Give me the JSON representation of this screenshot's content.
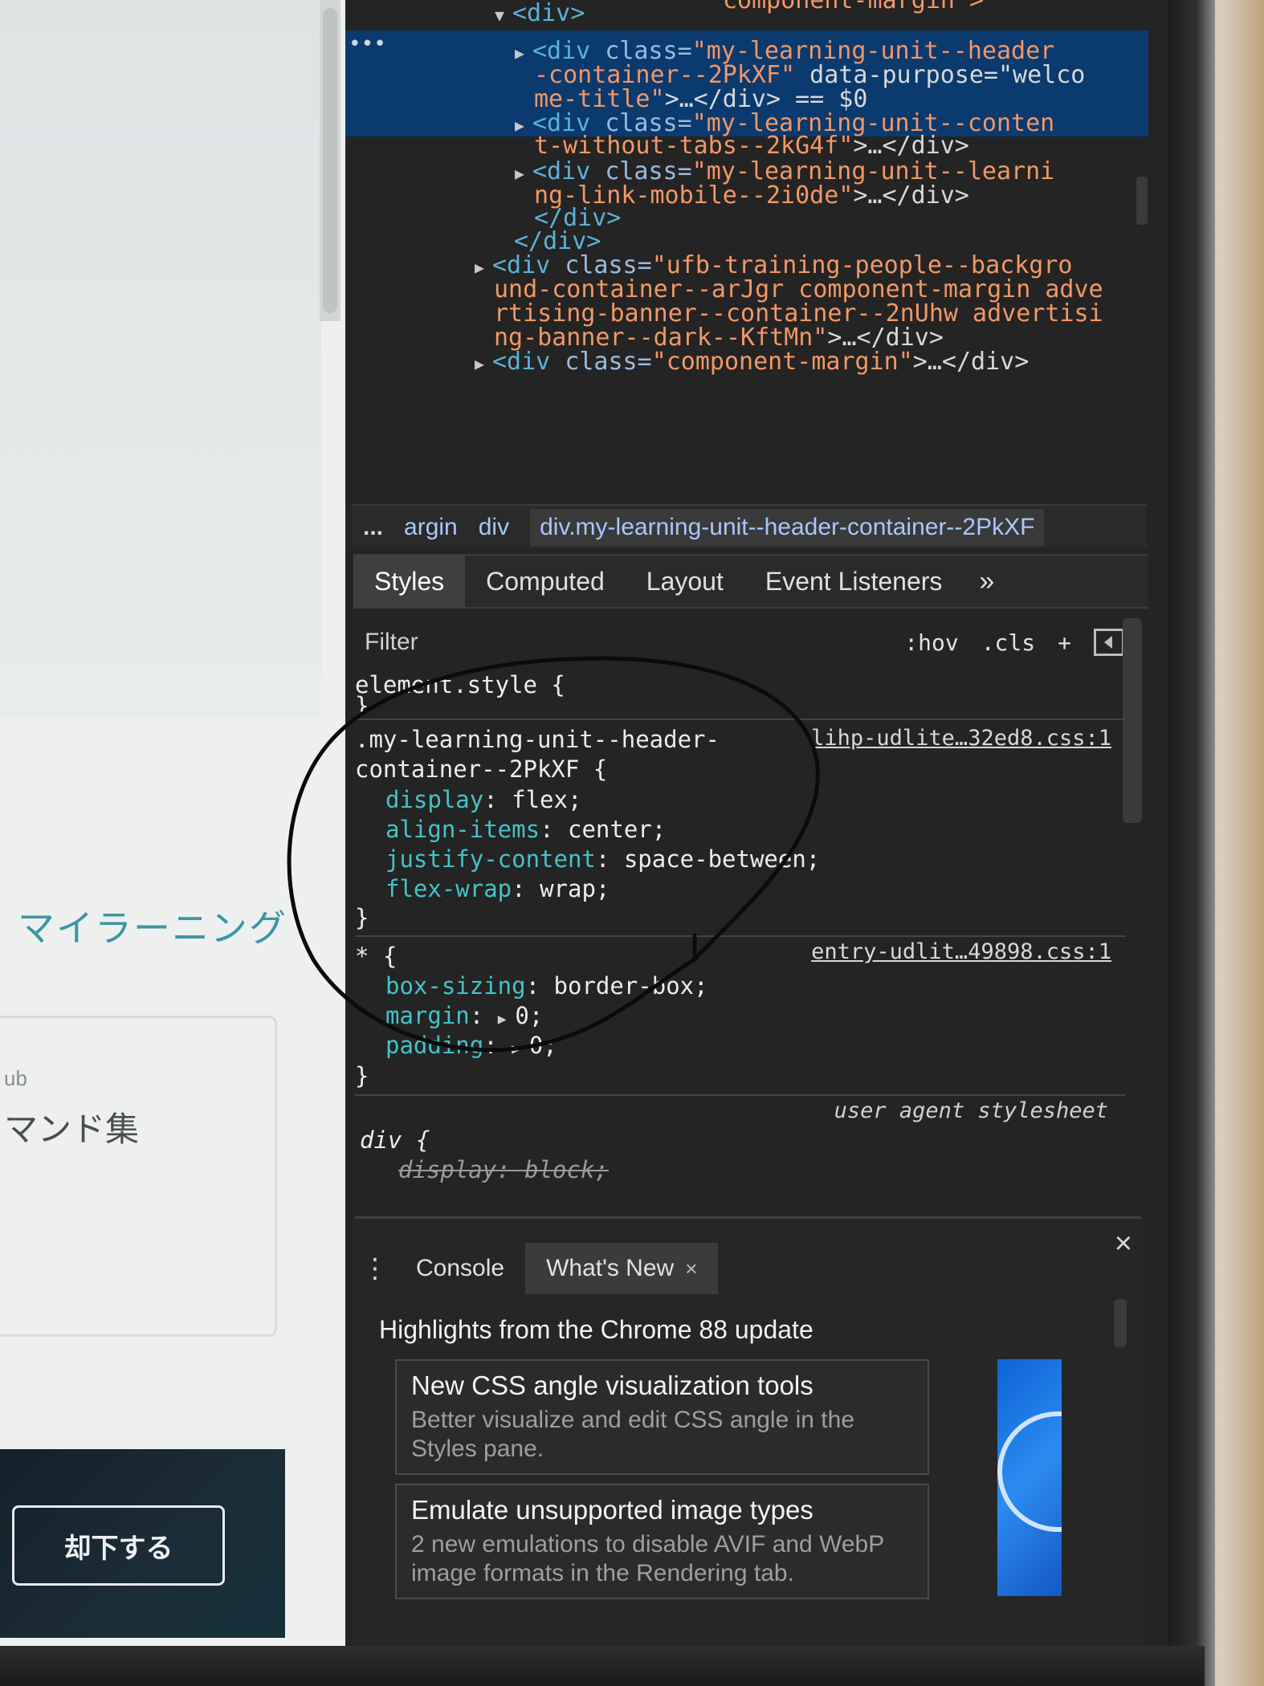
{
  "page": {
    "section_title": "マイラーニング",
    "card_subtitle": "ub",
    "card_title": "マンド集",
    "reject_button": "却下する"
  },
  "elements": {
    "lines": [
      {
        "open": "▼",
        "tag": "<div>",
        "attr": "",
        "val": "",
        "rest": ""
      },
      {
        "open": "▶",
        "tag": "<div ",
        "attr": "class=",
        "val": "\"my-learning-unit--header",
        "rest": ""
      },
      {
        "open": "",
        "tag": "",
        "attr": "",
        "val": "-container--2PkXF\"",
        "rest": " data-purpose=\"welco"
      },
      {
        "open": "",
        "tag": "",
        "attr": "",
        "val": "me-title\"",
        "rest": ">…</div> == $0"
      },
      {
        "open": "▶",
        "tag": "<div ",
        "attr": "class=",
        "val": "\"my-learning-unit--conten",
        "rest": ""
      },
      {
        "open": "",
        "tag": "",
        "attr": "",
        "val": "t-without-tabs--2kG4f\"",
        "rest": ">…</div>"
      },
      {
        "open": "▶",
        "tag": "<div ",
        "attr": "class=",
        "val": "\"my-learning-unit--learni",
        "rest": ""
      },
      {
        "open": "",
        "tag": "",
        "attr": "",
        "val": "ng-link-mobile--2i0de\"",
        "rest": ">…</div>"
      },
      {
        "open": "",
        "tag": "</div>",
        "attr": "",
        "val": "",
        "rest": ""
      },
      {
        "open": "",
        "tag": "</div>",
        "attr": "",
        "val": "",
        "rest": ""
      },
      {
        "open": "▶",
        "tag": "<div ",
        "attr": "class=",
        "val": "\"ufb-training-people--backgro",
        "rest": ""
      },
      {
        "open": "",
        "tag": "",
        "attr": "",
        "val": "und-container--arJgr component-margin adve",
        "rest": ""
      },
      {
        "open": "",
        "tag": "",
        "attr": "",
        "val": "rtising-banner--container--2nUhw advertisi",
        "rest": ""
      },
      {
        "open": "",
        "tag": "",
        "attr": "",
        "val": "ng-banner--dark--KftMn\"",
        "rest": ">…</div>"
      },
      {
        "open": "▶",
        "tag": "<div ",
        "attr": "class=",
        "val": "\"component-margin\"",
        "rest": ">…</div>"
      }
    ],
    "top_fragment": "component-margin\">"
  },
  "breadcrumb": {
    "ellipsis": "...",
    "items": [
      "argin",
      "div"
    ],
    "current": "div.my-learning-unit--header-container--2PkXF"
  },
  "tabs": [
    "Styles",
    "Computed",
    "Layout",
    "Event Listeners"
  ],
  "tabs_more": "»",
  "filter": {
    "placeholder": "Filter",
    "hov": ":hov",
    "cls": ".cls",
    "add": "+"
  },
  "styles": {
    "element_style_open": "element.style {",
    "element_style_close": "}",
    "rule1_selector_a": ".my-learning-unit--header-",
    "rule1_selector_b": "container--2PkXF {",
    "rule1_source": "lihp-udlite…32ed8.css:1",
    "rule1_props": [
      {
        "name": "display",
        "value": "flex;"
      },
      {
        "name": "align-items",
        "value": "center;"
      },
      {
        "name": "justify-content",
        "value": "space-between;"
      },
      {
        "name": "flex-wrap",
        "value": "wrap;"
      }
    ],
    "rule2_selector": "* {",
    "rule2_source": "entry-udlit…49898.css:1",
    "rule2_props": [
      {
        "name": "box-sizing",
        "value": "border-box;"
      },
      {
        "name": "margin",
        "value": "0;"
      },
      {
        "name": "padding",
        "value": "0;"
      }
    ],
    "close": "}",
    "ua_label": "user agent stylesheet",
    "ua_selector": "div {",
    "ua_prop": "display: block;"
  },
  "drawer": {
    "kebab": "⋮",
    "tabs": [
      "Console",
      "What's New"
    ],
    "tab_close": "×",
    "close": "×",
    "highlights": "Highlights from the Chrome 88 update",
    "features": [
      {
        "title": "New CSS angle visualization tools",
        "desc": "Better visualize and edit CSS angle in the Styles pane."
      },
      {
        "title": "Emulate unsupported image types",
        "desc": "2 new emulations to disable AVIF and WebP image formats in the Rendering tab."
      }
    ]
  },
  "colors": {
    "selection": "#0b3a6e",
    "css_property": "#43c3c8",
    "attr_value": "#f29766",
    "page_accent": "#3b97a3"
  }
}
